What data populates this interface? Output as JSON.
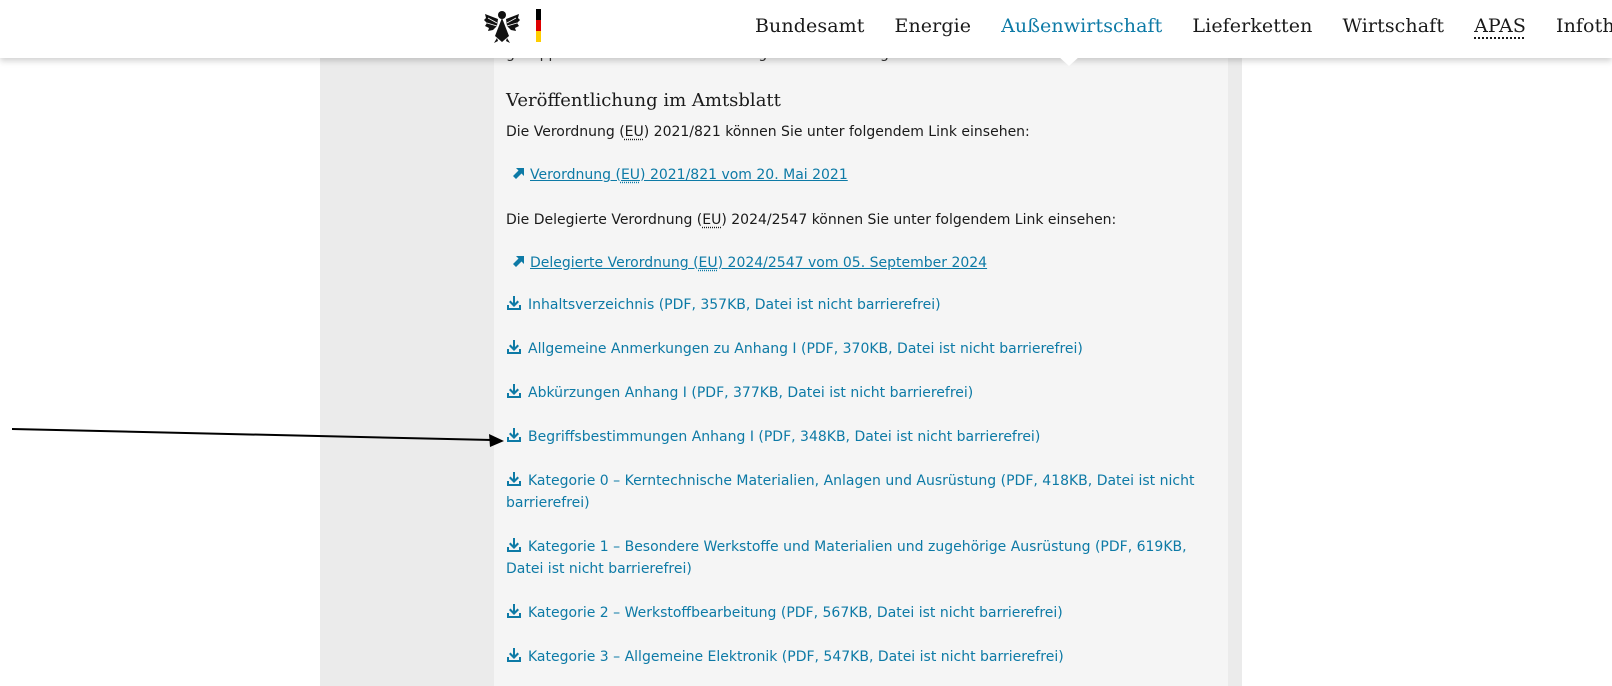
{
  "header": {
    "logo": {
      "eagle_icon": "federal-eagle-icon",
      "flag_colors": [
        "#000000",
        "#dd0000",
        "#ffce00"
      ]
    },
    "nav_items": [
      {
        "label": "Bundesamt"
      },
      {
        "label": "Energie"
      },
      {
        "label": "Außenwirtschaft",
        "active": true
      },
      {
        "label": "Lieferketten"
      },
      {
        "label": "Wirtschaft"
      },
      {
        "label": "APAS"
      },
      {
        "label": "Infothek"
      }
    ]
  },
  "main": {
    "cut_off_text": "gekoppelt zu Dual-Use-Güter Anhang I der Verordnung",
    "heading": "Veröffentlichung im Amtsblatt",
    "para1": {
      "prefix": "Die Verordnung (",
      "abbr": "EU",
      "suffix": ") 2021/821 können Sie unter folgendem Link einsehen:"
    },
    "link1": {
      "prefix": "Verordnung (",
      "abbr": "EU",
      "suffix": ") 2021/821 vom 20. Mai 2021"
    },
    "para2": {
      "prefix": "Die Delegierte Verordnung (",
      "abbr": "EU",
      "suffix": ") 2024/2547 können Sie unter folgendem Link einsehen:"
    },
    "link2": {
      "prefix": "Delegierte Verordnung (",
      "abbr": "EU",
      "suffix": ") 2024/2547 vom 05. September 2024"
    },
    "downloads": [
      {
        "label": "Inhaltsverzeichnis (PDF, 357KB, Datei ist nicht barrierefrei)"
      },
      {
        "label": "Allgemeine Anmerkungen zu Anhang I (PDF, 370KB, Datei ist nicht barrierefrei)"
      },
      {
        "label": "Abkürzungen Anhang I (PDF, 377KB, Datei ist nicht barrierefrei)"
      },
      {
        "label": "Begriffsbestimmungen Anhang I (PDF, 348KB, Datei ist nicht barrierefrei)"
      },
      {
        "label": "Kategorie 0 – Kerntechnische Materialien, Anlagen und Ausrüstung (PDF, 418KB, Datei ist nicht barrierefrei)"
      },
      {
        "label": "Kategorie 1 – Besondere Werkstoffe und Materialien und zugehörige Ausrüstung (PDF, 619KB, Datei ist nicht barrierefrei)"
      },
      {
        "label": "Kategorie 2 – Werkstoffbearbeitung (PDF, 567KB, Datei ist nicht barrierefrei)"
      },
      {
        "label": "Kategorie 3 – Allgemeine Elektronik (PDF, 547KB, Datei ist nicht barrierefrei)"
      }
    ]
  },
  "colors": {
    "link": "#0d7aa6",
    "text": "#1a1a1a",
    "panel": "#f5f5f5",
    "band": "#ebebeb"
  },
  "icons": {
    "external_link": "external-link-arrow-icon",
    "download": "download-icon",
    "annotation": "pointer-arrow"
  }
}
